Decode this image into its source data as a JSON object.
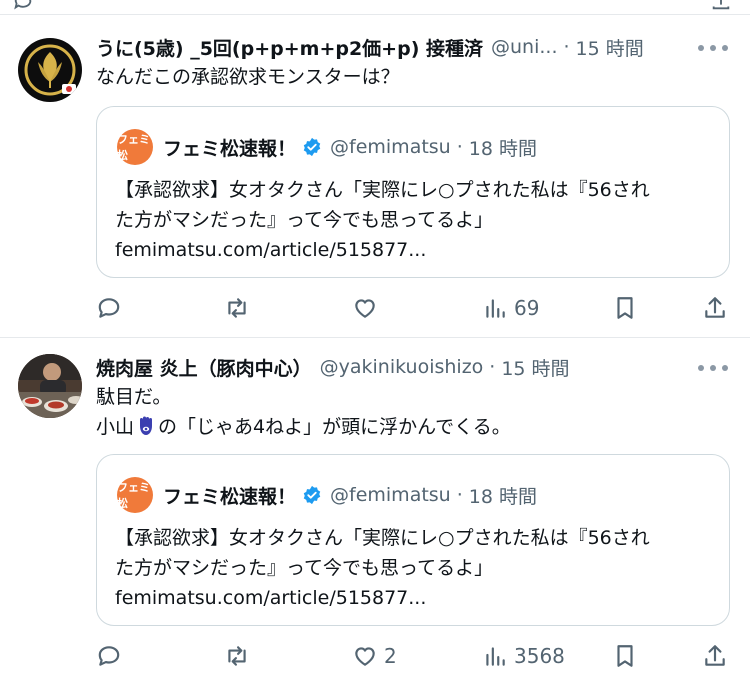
{
  "tweets": [
    {
      "name": "うに(5歳) _5回(p+p+m+p2価+p) 接種済",
      "handle": "@uni...",
      "time": "15 時間",
      "text_lines": [
        "なんだこの承認欲求モンスターは？"
      ],
      "quote": {
        "name": "フェミ松速報！",
        "handle": "@femimatsu",
        "time": "18 時間",
        "avatar_text": "フェミ松",
        "text_lines": [
          "【承認欲求】女オタクさん「実際にレ○プされた私は『56され",
          "た方がマシだった』って今でも思ってるよ」",
          "femimatsu.com/article/515877..."
        ]
      },
      "actions": {
        "reply": "",
        "retweet": "",
        "like": "",
        "views": "69"
      }
    },
    {
      "name": "焼肉屋 炎上（豚肉中心）",
      "handle": "@yakinikuoishizo",
      "time": "15 時間",
      "text_lines": [
        "駄目だ。",
        "小山",
        "の「じゃあ4ねよ」が頭に浮かんでくる。"
      ],
      "quote": {
        "name": "フェミ松速報！",
        "handle": "@femimatsu",
        "time": "18 時間",
        "avatar_text": "フェミ松",
        "text_lines": [
          "【承認欲求】女オタクさん「実際にレ○プされた私は『56され",
          "た方がマシだった』って今でも思ってるよ」",
          "femimatsu.com/article/515877..."
        ]
      },
      "actions": {
        "reply": "",
        "retweet": "",
        "like": "2",
        "views": "3568"
      }
    }
  ],
  "colors": {
    "muted": "#536471",
    "verified": "#1d9bf0",
    "border": "#cfd9de",
    "quote_avatar": "#f07a3a"
  },
  "icons": [
    "reply-icon",
    "retweet-icon",
    "like-icon",
    "views-icon",
    "bookmark-icon",
    "share-icon",
    "verified-badge-icon",
    "more-icon"
  ]
}
